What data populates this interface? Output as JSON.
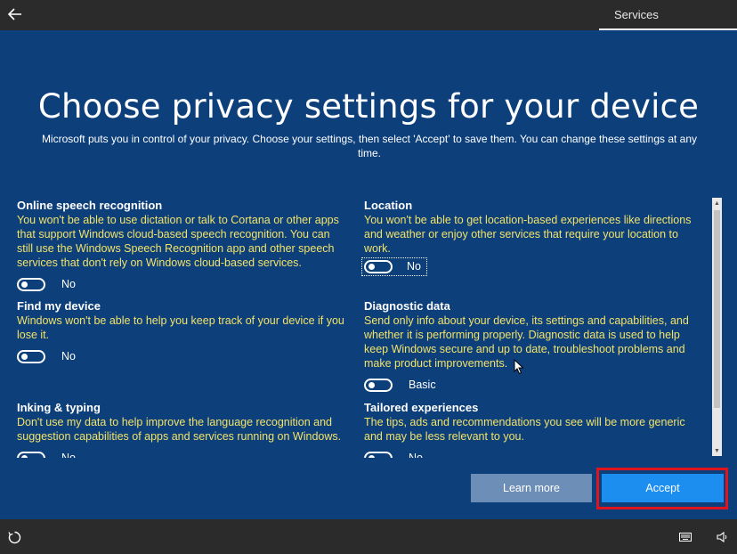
{
  "topbar": {
    "back_icon": "back-arrow-icon",
    "title": "Services"
  },
  "page": {
    "heading": "Choose privacy settings for your device",
    "subtitle": "Microsoft puts you in control of your privacy. Choose your settings, then select 'Accept' to save them. You can change these settings at any time."
  },
  "settings": {
    "speech": {
      "title": "Online speech recognition",
      "description": "You won't be able to use dictation or talk to Cortana or other apps that support Windows cloud-based speech recognition. You can still use the Windows Speech Recognition app and other speech services that don't rely on Windows cloud-based services.",
      "toggle_label": "No",
      "on": false
    },
    "location": {
      "title": "Location",
      "description": "You won't be able to get location-based experiences like directions and weather or enjoy other services that require your location to work.",
      "toggle_label": "No",
      "on": false
    },
    "find_device": {
      "title": "Find my device",
      "description": "Windows won't be able to help you keep track of your device if you lose it.",
      "toggle_label": "No",
      "on": false
    },
    "diagnostic": {
      "title": "Diagnostic data",
      "description": "Send only info about your device, its settings and capabilities, and whether it is performing properly. Diagnostic data is used to help keep Windows secure and up to date, troubleshoot problems and make product improvements.",
      "toggle_label": "Basic",
      "on": false
    },
    "inking": {
      "title": "Inking & typing",
      "description": "Don't use my data to help improve the language recognition and suggestion capabilities of apps and services running on Windows.",
      "toggle_label": "No",
      "on": false
    },
    "tailored": {
      "title": "Tailored experiences",
      "description": "The tips, ads and recommendations you see will be more generic and may be less relevant to you.",
      "toggle_label": "No",
      "on": false
    }
  },
  "buttons": {
    "learn_more": "Learn more",
    "accept": "Accept"
  },
  "bottombar": {
    "left_icon": "ease-of-access-icon",
    "right_icons": [
      "keyboard-icon",
      "volume-icon"
    ]
  },
  "colors": {
    "background": "#0d3f7a",
    "description_text": "#f2e36a",
    "accept_button": "#1c8ef0",
    "learn_more_button": "#6d8eb6",
    "highlight_border": "#e0141e"
  }
}
